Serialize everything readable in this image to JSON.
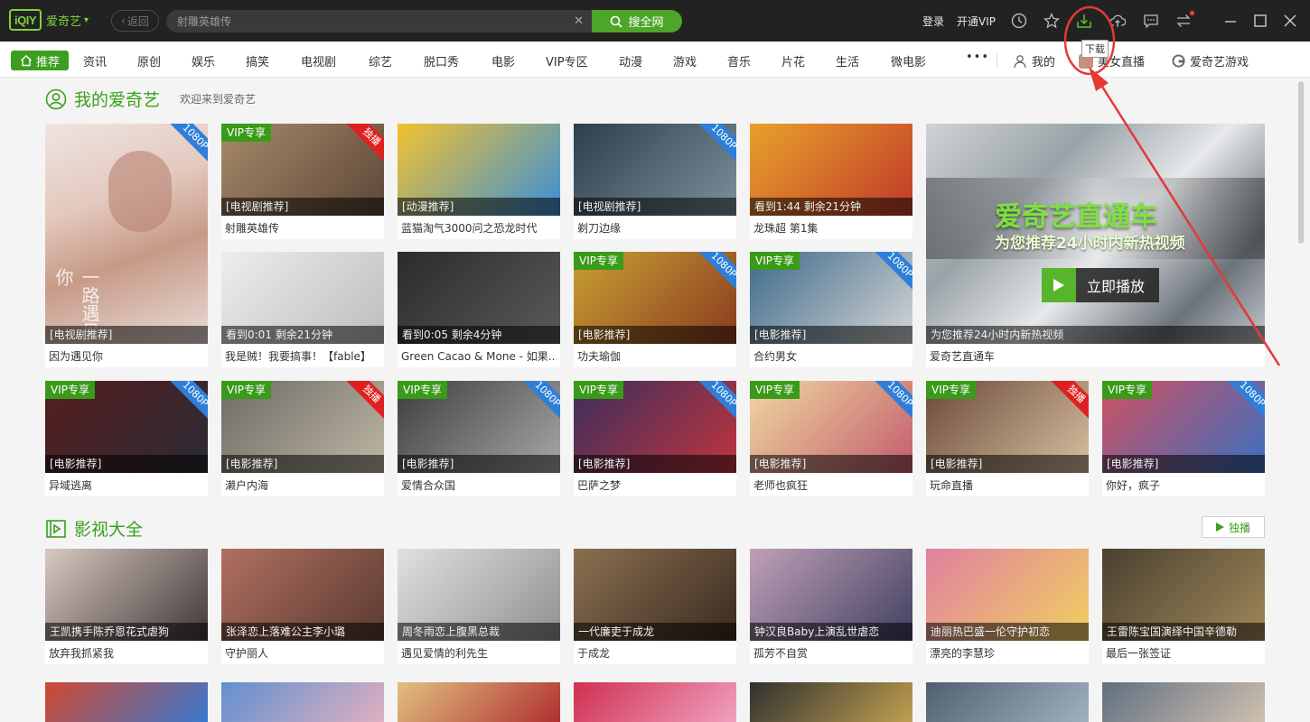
{
  "colors": {
    "accent": "#3aa01d",
    "topbar": "#222222",
    "vip": "#3a9a1a",
    "badge_blue": "#2f7fd8",
    "badge_red": "#e02020",
    "annotation": "#e53935"
  },
  "topbar": {
    "logo": "iQIY",
    "app_name": "爱奇艺",
    "back_label": "返回",
    "search_value": "射雕英雄传",
    "search_button": "搜全网",
    "login": "登录",
    "vip": "开通VIP",
    "icons": [
      "history-icon",
      "star-icon",
      "download-icon",
      "upload-cloud-icon",
      "message-icon",
      "transfer-icon",
      "minimize-icon",
      "maximize-icon",
      "close-icon"
    ],
    "tooltip": "下载"
  },
  "nav": {
    "home": "推荐",
    "items": [
      "资讯",
      "原创",
      "娱乐",
      "搞笑",
      "电视剧",
      "综艺",
      "脱口秀",
      "电影",
      "VIP专区",
      "动漫",
      "游戏",
      "音乐",
      "片花",
      "生活",
      "微电影"
    ],
    "more": "•••",
    "mine": "我的",
    "live": "美女直播",
    "game": "爱奇艺游戏"
  },
  "section1": {
    "title": "我的爱奇艺",
    "subtitle": "欢迎来到爱奇艺",
    "featured": {
      "caption": "[电视剧推荐]",
      "title": "因为遇见你",
      "badge": "1080P",
      "overlay": "一路遇见你"
    },
    "hero": {
      "headline": "爱奇艺直通车",
      "subline": "为您推荐24小时内新热视频",
      "button": "立即播放",
      "caption": "为您推荐24小时内新热视频",
      "title": "爱奇艺直通车"
    },
    "row1": [
      {
        "vip": "VIP专享",
        "badge": "独播",
        "caption": "[电视剧推荐]",
        "title": "射雕英雄传"
      },
      {
        "vip": "",
        "badge": "",
        "caption": "[动漫推荐]",
        "title": "蓝猫淘气3000问之恐龙时代"
      },
      {
        "vip": "",
        "badge": "1080P",
        "caption": "[电视剧推荐]",
        "title": "剃刀边缘"
      },
      {
        "vip": "",
        "badge": "",
        "caption": "看到1:44 剩余21分钟",
        "title": "龙珠超 第1集"
      }
    ],
    "row2": [
      {
        "vip": "",
        "badge": "",
        "caption": "看到0:01 剩余21分钟",
        "title": "我是贼！我要搞事！【fable】"
      },
      {
        "vip": "",
        "badge": "",
        "caption": "看到0:05 剩余4分钟",
        "title": "Green Cacao & Mone - 如果..."
      },
      {
        "vip": "VIP专享",
        "badge": "1080P",
        "caption": "[电影推荐]",
        "title": "功夫瑜伽"
      },
      {
        "vip": "VIP专享",
        "badge": "1080P",
        "caption": "[电影推荐]",
        "title": "合约男女"
      }
    ],
    "row3": [
      {
        "vip": "VIP专享",
        "badge": "1080P",
        "caption": "[电影推荐]",
        "title": "异域逃离"
      },
      {
        "vip": "VIP专享",
        "badge": "独播",
        "caption": "[电影推荐]",
        "title": "濑户内海"
      },
      {
        "vip": "VIP专享",
        "badge": "1080P",
        "caption": "[电影推荐]",
        "title": "爱情合众国"
      },
      {
        "vip": "VIP专享",
        "badge": "1080P",
        "caption": "[电影推荐]",
        "title": "巴萨之梦"
      },
      {
        "vip": "VIP专享",
        "badge": "1080P",
        "caption": "[电影推荐]",
        "title": "老师也疯狂"
      },
      {
        "vip": "VIP专享",
        "badge": "独播",
        "caption": "[电影推荐]",
        "title": "玩命直播"
      },
      {
        "vip": "VIP专享",
        "badge": "1080P",
        "caption": "[电影推荐]",
        "title": "你好，疯子"
      }
    ]
  },
  "section2": {
    "title": "影视大全",
    "exclusive": "独播",
    "row": [
      {
        "caption": "王凯携手陈乔恩花式虐狗",
        "title": "放弃我抓紧我"
      },
      {
        "caption": "张泽恋上落难公主李小璐",
        "title": "守护丽人"
      },
      {
        "caption": "周冬雨恋上腹黑总裁",
        "title": "遇见爱情的利先生"
      },
      {
        "caption": "一代廉吏于成龙",
        "title": "于成龙"
      },
      {
        "caption": "钟汉良Baby上演乱世虐恋",
        "title": "孤芳不自赏"
      },
      {
        "caption": "迪丽热巴盛一伦守护初恋",
        "title": "漂亮的李慧珍"
      },
      {
        "caption": "王雷陈宝国演绎中国辛德勒",
        "title": "最后一张签证"
      }
    ]
  }
}
